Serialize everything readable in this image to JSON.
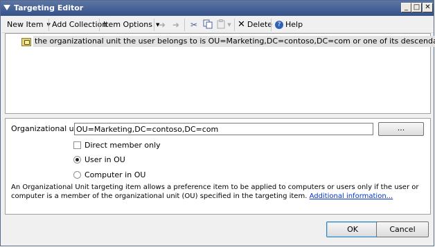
{
  "window": {
    "title": "Targeting Editor",
    "minimize_label": "_",
    "maximize_label": "□",
    "close_label": "✕"
  },
  "toolbar": {
    "new_item_label": "New Item",
    "add_collection_label": "Add Collection",
    "item_options_label": "Item Options",
    "delete_label": "Delete",
    "help_label": "Help"
  },
  "tree": {
    "items": [
      {
        "label": "the organizational unit the user belongs to is OU=Marketing,DC=contoso,DC=com or one of its descendants"
      }
    ]
  },
  "properties": {
    "ou_label": "Organizational unit",
    "ou_value": "OU=Marketing,DC=contoso,DC=com",
    "browse_label": "...",
    "direct_member_label": "Direct member only",
    "direct_member_checked": false,
    "user_in_ou_label": "User in OU",
    "computer_in_ou_label": "Computer in OU",
    "selected_scope": "User in OU",
    "description": "An Organizational Unit targeting item allows a preference item to be applied to computers or users only if the user or computer is a member of the organizational unit (OU) specified in the targeting item.",
    "more_info_link": "Additional information..."
  },
  "footer": {
    "ok_label": "OK",
    "cancel_label": "Cancel"
  },
  "colors": {
    "titlebar": "#34518a",
    "link": "#0033cc",
    "selection": "#e2e2e2"
  }
}
